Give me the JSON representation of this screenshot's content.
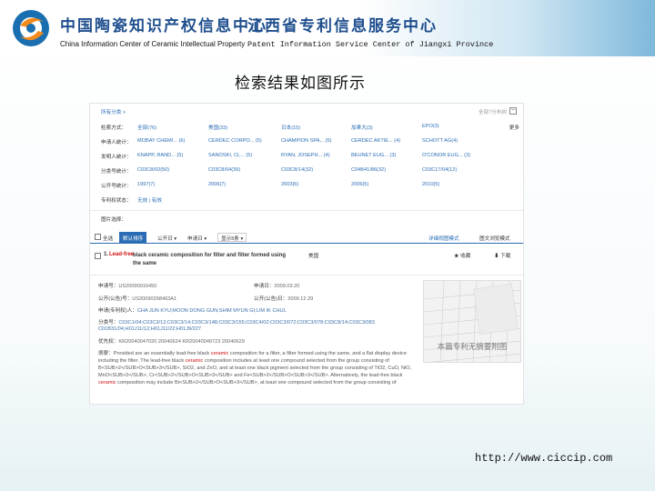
{
  "header": {
    "org1_cn": "中国陶瓷知识产权信息中心",
    "org2_cn": "江西省专利信息服务中心",
    "org1_en": "China Information Center of Ceramic Intellectual Property",
    "org2_en": "Patent Information Service Center of  Jiangxi  Province"
  },
  "slide_title": "检索结果如图所示",
  "footer_url": "http://www.ciccip.com",
  "screenshot": {
    "filter_top": {
      "left": "所有分类 >",
      "right": "全部7分布树",
      "toggle": "−"
    },
    "filter_rows": [
      {
        "label": "检索方式：",
        "items": [
          "全部(76)",
          "美国(33)",
          "日本(15)",
          "加拿大(3)",
          "EPO(3)"
        ],
        "more": "更多"
      },
      {
        "label": "申请人统计：",
        "items": [
          "MOBAY CHEMI... (6)",
          "CERDEC CORPO... (5)",
          "CHAMPION SPA... (5)",
          "CERDEC AKTIE... (4)",
          "SCHOTT AG(4)"
        ],
        "more": ""
      },
      {
        "label": "发明人统计：",
        "items": [
          "KNAPP, RAND... (5)",
          "SANOSKI, CL... (5)",
          "RYAN, JOSEPH... (4)",
          "BEUNET EUG... (3)",
          "O'CONOR EUG... (3)"
        ],
        "more": ""
      },
      {
        "label": "分类号统计：",
        "items": [
          "C03C8/02(50)",
          "C03C8/04(39)",
          "C03C8/14(32)",
          "C04B41/86(32)",
          "C03C17/04(12)"
        ],
        "more": ""
      },
      {
        "label": "公开号统计：",
        "items": [
          "1997(7)",
          "2006(7)",
          "2003(6)",
          "2006(5)",
          "2010(5)"
        ],
        "more": ""
      },
      {
        "label": "专利权状态：",
        "items": [
          "无效 | 有效"
        ],
        "more": ""
      }
    ],
    "subhead": "图片选择：",
    "toolbar": {
      "select_all": "全选",
      "buttons": [
        "默认排序",
        "公开日 ▾",
        "申请日 ▾"
      ],
      "select": "显示5条 ▾",
      "right1": "详细视图模式",
      "right2": "图文浏览模式"
    },
    "result": {
      "num": "1.",
      "highlight": "Lead-free",
      "rest": " black ceramic composition for filter and filter formed using the same",
      "country": "美国",
      "favorite": "★ 收藏",
      "download": "⬇ 下载"
    },
    "details": [
      {
        "k": "申请号：",
        "v": "US20090016450",
        "k2": "申请日：",
        "v2": "2009.03.20"
      },
      {
        "k": "公开(公告)号：",
        "v": "US20090268463A1",
        "k2": "公开(公告)日：",
        "v2": "2009.12.29"
      },
      {
        "k": "申请(专利权)人：",
        "v": "CHA JUN KYU;MOON DONG GUN;SHIM MYUN GI;LIM IK CHUL",
        "k2": "",
        "v2": ""
      },
      {
        "k": "分类号：",
        "v": "C03C1/04;C03C3/12;C03C3/14;C03C3/148;C03C3/155;C03C4/02;C03C3/072;C03C3/078;C03C8/14;C03C3/083",
        "k2": "",
        "v2": ""
      },
      {
        "k": "",
        "v": "C01B31/04;H01J11/12;H01J11/22;H01J9/227",
        "k2": "",
        "v2": ""
      },
      {
        "k": "优先权：",
        "v": "KR20040047020 20040624 KR20040049723 20040629",
        "k2": "",
        "v2": ""
      }
    ],
    "abstract": {
      "label": "摘要：",
      "text_before": "Provided are an essentially lead-free black ",
      "hl1": "ceramic",
      "text_mid": " composition for a filter, a filter formed using the same, and a flat display device including the filter. The lead-free black ",
      "hl2": "ceramic",
      "text_after": " composition includes at least one compound selected from the group consisting of B<SUB>2</SUB>O<SUB>3</SUB>, SiO2, and ZnO, and at least one black pigment selected from the group consisting of TiO2, CuO, NiO, MnO<SUB>2</SUB>, Cr<SUB>2</SUB>O<SUB>3</SUB> and Fe<SUB>2</SUB>O<SUB>3</SUB>. Alternatively, the lead-free black ",
      "hl3": "ceramic",
      "text_end": " composition may include Bi<SUB>2</SUB>O<SUB>3</SUB>, at least one compound selected from the group consisting of"
    },
    "thumbnail_caption": "本篇专利无摘要附图"
  }
}
